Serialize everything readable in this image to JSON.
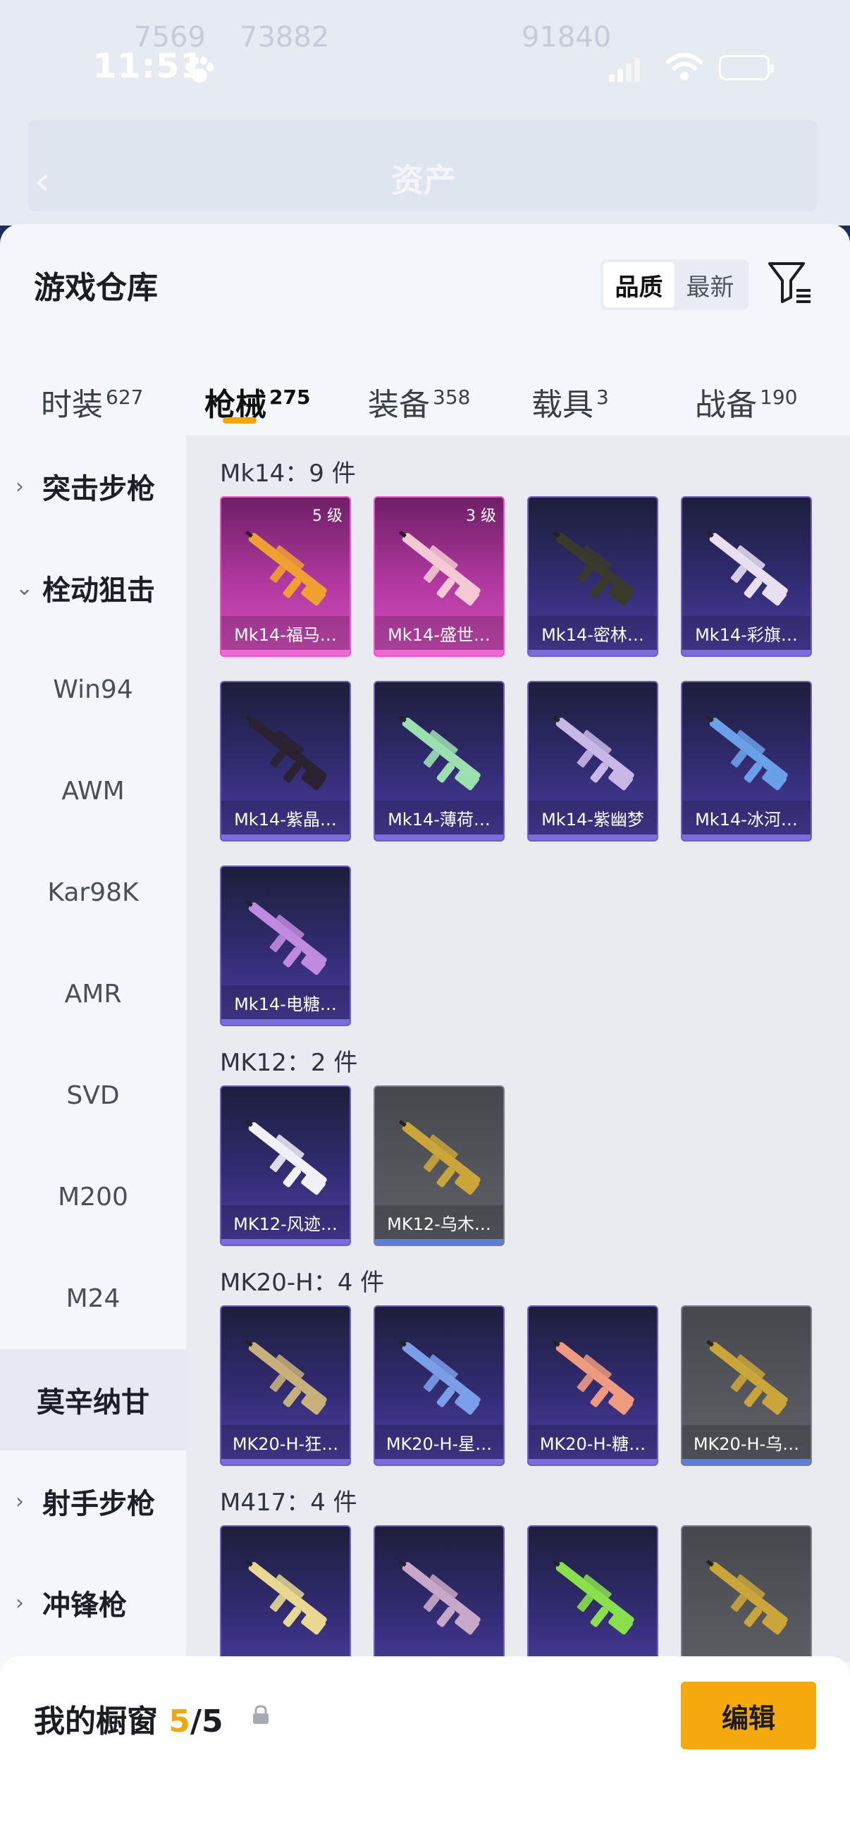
{
  "status_bar": {
    "time": "11:51"
  },
  "background": {
    "title": "资产",
    "stats": [
      "7569",
      "73882",
      "91840"
    ]
  },
  "sheet": {
    "title": "游戏仓库",
    "sort": {
      "options": [
        "品质",
        "最新"
      ],
      "active": "品质"
    }
  },
  "tabs": [
    {
      "label": "时装",
      "count": "627"
    },
    {
      "label": "枪械",
      "count": "275"
    },
    {
      "label": "装备",
      "count": "358"
    },
    {
      "label": "载具",
      "count": "3"
    },
    {
      "label": "战备",
      "count": "190"
    }
  ],
  "active_tab": "枪械",
  "sidebar": {
    "items": [
      {
        "label": "突击步枪",
        "type": "category",
        "expanded": false
      },
      {
        "label": "栓动狙击",
        "type": "category",
        "expanded": true
      },
      {
        "label": "Win94",
        "type": "item"
      },
      {
        "label": "AWM",
        "type": "item"
      },
      {
        "label": "Kar98K",
        "type": "item"
      },
      {
        "label": "AMR",
        "type": "item"
      },
      {
        "label": "SVD",
        "type": "item"
      },
      {
        "label": "M200",
        "type": "item"
      },
      {
        "label": "M24",
        "type": "item"
      },
      {
        "label": "莫辛纳甘",
        "type": "item",
        "selected": true
      },
      {
        "label": "射手步枪",
        "type": "category",
        "expanded": false
      },
      {
        "label": "冲锋枪",
        "type": "category",
        "expanded": false
      }
    ]
  },
  "sections": [
    {
      "title": "Mk14：9 件",
      "items": [
        {
          "name": "Mk14-福马…",
          "level": "5 级",
          "tier": "pink",
          "color": "#f0a030"
        },
        {
          "name": "Mk14-盛世…",
          "level": "3 级",
          "tier": "pink",
          "color": "#f4c8d4"
        },
        {
          "name": "Mk14-密林…",
          "tier": "purple",
          "color": "#3a3a2a"
        },
        {
          "name": "Mk14-彩旗…",
          "tier": "purple",
          "color": "#e8e0f0"
        },
        {
          "name": "Mk14-紫晶…",
          "tier": "purple",
          "color": "#2a2230"
        },
        {
          "name": "Mk14-薄荷…",
          "tier": "purple",
          "color": "#9de0b0"
        },
        {
          "name": "Mk14-紫幽梦",
          "tier": "purple",
          "color": "#c8b8e8"
        },
        {
          "name": "Mk14-冰河…",
          "tier": "purple",
          "color": "#6aa0e8"
        },
        {
          "name": "Mk14-电糖…",
          "tier": "purple",
          "color": "#c08ae0"
        }
      ]
    },
    {
      "title": "MK12：2 件",
      "items": [
        {
          "name": "MK12-风迹…",
          "tier": "purple",
          "color": "#f0f0f6"
        },
        {
          "name": "MK12-乌木…",
          "tier": "grey",
          "color": "#c9a53a"
        }
      ]
    },
    {
      "title": "MK20-H：4 件",
      "items": [
        {
          "name": "MK20-H-狂…",
          "tier": "purple",
          "color": "#c8b07a"
        },
        {
          "name": "MK20-H-星…",
          "tier": "purple",
          "color": "#7a9ee8"
        },
        {
          "name": "MK20-H-糖…",
          "tier": "purple",
          "color": "#f09a80"
        },
        {
          "name": "MK20-H-乌…",
          "tier": "grey",
          "color": "#c9a53a"
        }
      ]
    },
    {
      "title": "M417：4 件",
      "items": [
        {
          "name": "",
          "tier": "purple",
          "color": "#e8d890"
        },
        {
          "name": "",
          "tier": "purple",
          "color": "#c8a8c8"
        },
        {
          "name": "",
          "tier": "purple",
          "color": "#8ae04a"
        },
        {
          "name": "",
          "tier": "grey",
          "color": "#c9a53a"
        }
      ]
    }
  ],
  "showcase": {
    "label": "我的橱窗",
    "current": "5",
    "max": "5",
    "edit_label": "编辑"
  },
  "colors": {
    "accent": "#f6a90f",
    "pink_tier": "#e957c8",
    "purple_tier": "#6f5ec4",
    "grey_tier": "#7d7f86"
  }
}
